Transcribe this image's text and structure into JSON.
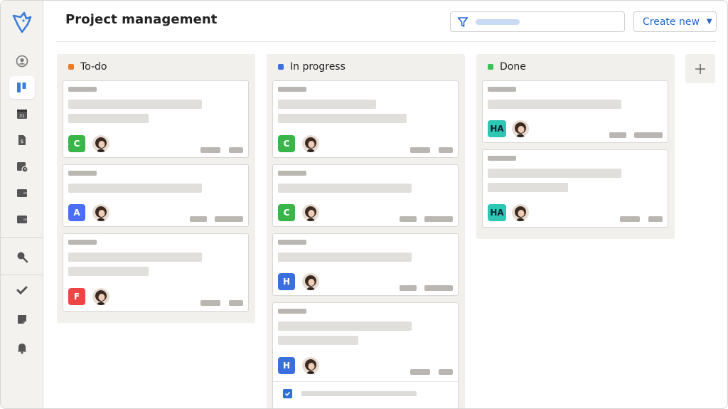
{
  "header": {
    "title": "Project management",
    "create_label": "Create new"
  },
  "filter": {
    "placeholder": ""
  },
  "sidebar": {
    "items": [
      {
        "icon": "user-circle-icon"
      },
      {
        "icon": "board-icon",
        "active": true
      },
      {
        "icon": "calendar-icon",
        "text": "31"
      },
      {
        "icon": "invoice-icon",
        "text": "$"
      },
      {
        "icon": "schedule-icon"
      },
      {
        "icon": "wallet-icon"
      },
      {
        "icon": "wallet-alt-icon"
      },
      {
        "icon": "search-icon"
      },
      {
        "icon": "check-icon"
      },
      {
        "icon": "note-icon"
      },
      {
        "icon": "bell-icon"
      }
    ]
  },
  "columns": [
    {
      "title": "To-do",
      "color": "#f07a22",
      "cards": [
        {
          "badge": "C",
          "badge_color": "#39b54a"
        },
        {
          "badge": "A",
          "badge_color": "#4c6ef5"
        },
        {
          "badge": "F",
          "badge_color": "#ee4444"
        }
      ]
    },
    {
      "title": "In progress",
      "color": "#3b6fe0",
      "cards": [
        {
          "badge": "C",
          "badge_color": "#39b54a"
        },
        {
          "badge": "C",
          "badge_color": "#39b54a"
        },
        {
          "badge": "H",
          "badge_color": "#3b6fe0"
        },
        {
          "badge": "H",
          "badge_color": "#3b6fe0",
          "has_checklist": true
        }
      ]
    },
    {
      "title": "Done",
      "color": "#3fbf58",
      "cards": [
        {
          "badge": "HA",
          "badge_color": "#2ec7b4"
        },
        {
          "badge": "HA",
          "badge_color": "#2ec7b4"
        }
      ]
    }
  ],
  "colors": {
    "accent": "#2266cc",
    "sidebar_bg": "#f3f2ef",
    "column_bg": "#f1f0ed"
  }
}
